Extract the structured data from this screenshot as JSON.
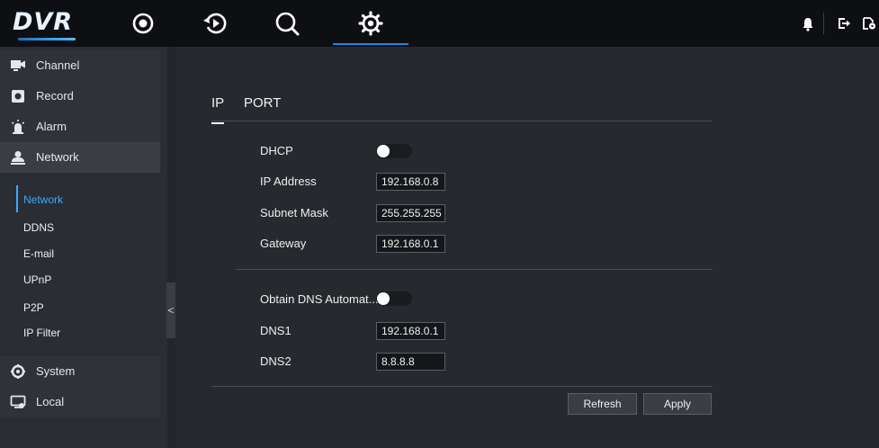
{
  "app": {
    "logo": "DVR"
  },
  "topnav": {
    "icons": [
      "live-view-icon",
      "playback-icon",
      "search-icon",
      "settings-icon"
    ],
    "active": "settings-icon",
    "right_icons": [
      "bell-icon",
      "logout-icon",
      "lock-icon"
    ]
  },
  "sidebar": {
    "items": [
      {
        "label": "Channel",
        "icon": "channel-icon"
      },
      {
        "label": "Record",
        "icon": "record-icon"
      },
      {
        "label": "Alarm",
        "icon": "alarm-icon"
      },
      {
        "label": "Network",
        "icon": "network-icon"
      },
      {
        "label": "System",
        "icon": "system-icon"
      },
      {
        "label": "Local",
        "icon": "local-icon"
      }
    ],
    "network_sub": [
      {
        "label": "Network"
      },
      {
        "label": "DDNS"
      },
      {
        "label": "E-mail"
      },
      {
        "label": "UPnP"
      },
      {
        "label": "P2P"
      },
      {
        "label": "IP Filter"
      }
    ],
    "collapse_glyph": "<"
  },
  "main": {
    "tabs": [
      {
        "label": "IP"
      },
      {
        "label": "PORT"
      }
    ],
    "fields": {
      "dhcp": {
        "label": "DHCP",
        "on": false
      },
      "ip_address": {
        "label": "IP Address",
        "value": "192.168.0.8"
      },
      "subnet_mask": {
        "label": "Subnet Mask",
        "value": "255.255.255"
      },
      "gateway": {
        "label": "Gateway",
        "value": "192.168.0.1"
      },
      "obtain_dns": {
        "label": "Obtain DNS Automat...",
        "on": false
      },
      "dns1": {
        "label": "DNS1",
        "value": "192.168.0.1"
      },
      "dns2": {
        "label": "DNS2",
        "value": "8.8.8.8"
      }
    },
    "buttons": {
      "refresh": "Refresh",
      "apply": "Apply"
    }
  },
  "colors": {
    "accent": "#3ea6ff",
    "topbar": "#0e0f12",
    "background": "#26292e"
  }
}
